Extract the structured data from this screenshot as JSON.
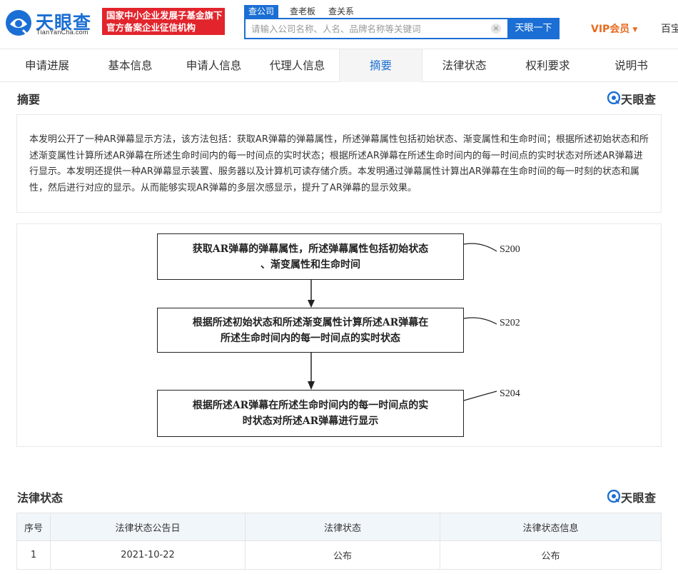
{
  "header": {
    "logo_cn": "天眼查",
    "logo_en": "TianYanCha.com",
    "badge_line1": "国家中小企业发展子基金旗下",
    "badge_line2": "官方备案企业征信机构",
    "search_tabs": [
      "查公司",
      "查老板",
      "查关系"
    ],
    "search_placeholder": "请输入公司名称、人名、品牌名称等关键词",
    "clear_symbol": "×",
    "search_button": "天眼一下",
    "vip_label": "VIP会员",
    "vip_caret": "▼",
    "truncated_link": "百宝"
  },
  "tabs": [
    {
      "label": "申请进展"
    },
    {
      "label": "基本信息"
    },
    {
      "label": "申请人信息"
    },
    {
      "label": "代理人信息"
    },
    {
      "label": "摘要",
      "active": true
    },
    {
      "label": "法律状态"
    },
    {
      "label": "权利要求"
    },
    {
      "label": "说明书"
    }
  ],
  "watermark": "天眼查",
  "abstract": {
    "title": "摘要",
    "text": "本发明公开了一种AR弹幕显示方法，该方法包括：获取AR弹幕的弹幕属性，所述弹幕属性包括初始状态、渐变属性和生命时间；根据所述初始状态和所述渐变属性计算所述AR弹幕在所述生命时间内的每一时间点的实时状态；根据所述AR弹幕在所述生命时间内的每一时间点的实时状态对所述AR弹幕进行显示。本发明还提供一种AR弹幕显示装置、服务器以及计算机可读存储介质。本发明通过弹幕属性计算出AR弹幕在生命时间的每一时刻的状态和属性，然后进行对应的显示。从而能够实现AR弹幕的多层次感显示，提升了AR弹幕的显示效果。"
  },
  "flowchart": {
    "steps": [
      {
        "line1": "获取AR弹幕的弹幕属性，所述弹幕属性包括初始状态",
        "line2": "、渐变属性和生命时间",
        "label": "S200"
      },
      {
        "line1": "根据所述初始状态和所述渐变属性计算所述AR弹幕在",
        "line2": "所述生命时间内的每一时间点的实时状态",
        "label": "S202"
      },
      {
        "line1": "根据所述AR弹幕在所述生命时间内的每一时间点的实",
        "line2": "时状态对所述AR弹幕进行显示",
        "label": "S204"
      }
    ]
  },
  "legal": {
    "title": "法律状态",
    "columns": [
      "序号",
      "法律状态公告日",
      "法律状态",
      "法律状态信息"
    ],
    "rows": [
      [
        "1",
        "2021-10-22",
        "公布",
        "公布"
      ]
    ]
  },
  "colors": {
    "brand_blue": "#1b6fd4",
    "badge_red": "#e2242c",
    "vip_orange": "#e86b1f"
  }
}
